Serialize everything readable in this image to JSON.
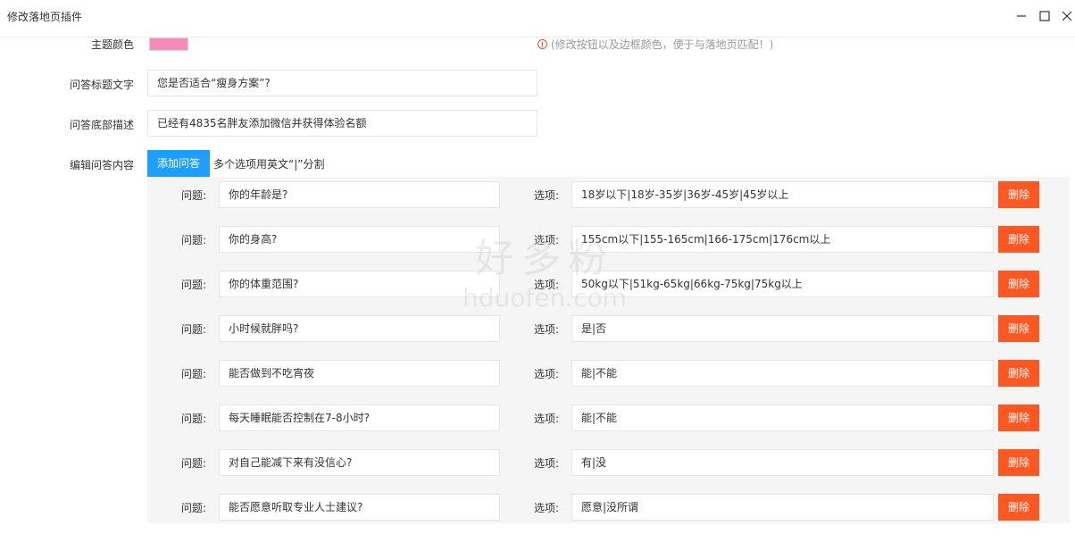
{
  "window": {
    "title": "修改落地页插件"
  },
  "form": {
    "theme_color": {
      "label": "主题颜色",
      "value": "#f68ab8",
      "hint": "(修改按钮以及边框颜色，便于与落地页匹配！)"
    },
    "qa_title": {
      "label": "问答标题文字",
      "value": "您是否适合“瘦身方案”?"
    },
    "qa_footer": {
      "label": "问答底部描述",
      "value": "已经有4835名胖友添加微信并获得体验名额"
    },
    "qa_edit": {
      "label": "编辑问答内容",
      "add_button": "添加问答",
      "add_hint": "多个选项用英文“|”分割"
    }
  },
  "qa_items": [
    {
      "q_label": "问题:",
      "question": "你的年龄是?",
      "o_label": "选项:",
      "options": "18岁以下|18岁-35岁|36岁-45岁|45岁以上",
      "delete": "删除"
    },
    {
      "q_label": "问题:",
      "question": "你的身高?",
      "o_label": "选项:",
      "options": "155cm以下|155-165cm|166-175cm|176cm以上",
      "delete": "删除"
    },
    {
      "q_label": "问题:",
      "question": "你的体重范围?",
      "o_label": "选项:",
      "options": "50kg以下|51kg-65kg|66kg-75kg|75kg以上",
      "delete": "删除"
    },
    {
      "q_label": "问题:",
      "question": "小时候就胖吗?",
      "o_label": "选项:",
      "options": "是|否",
      "delete": "删除"
    },
    {
      "q_label": "问题:",
      "question": "能否做到不吃宵夜",
      "o_label": "选项:",
      "options": "能|不能",
      "delete": "删除"
    },
    {
      "q_label": "问题:",
      "question": "每天睡眠能否控制在7-8小时?",
      "o_label": "选项:",
      "options": "能|不能",
      "delete": "删除"
    },
    {
      "q_label": "问题:",
      "question": "对自己能减下来有没信心?",
      "o_label": "选项:",
      "options": "有|没",
      "delete": "删除"
    },
    {
      "q_label": "问题:",
      "question": "能否愿意听取专业人士建议?",
      "o_label": "选项:",
      "options": "愿意|没所谓",
      "delete": "删除"
    }
  ],
  "watermark": {
    "cn": "好多粉",
    "en": "hduofen.com"
  },
  "colors": {
    "add_button": "#1e9fff",
    "delete_button": "#ff5722",
    "info_icon": "#e4572e"
  }
}
